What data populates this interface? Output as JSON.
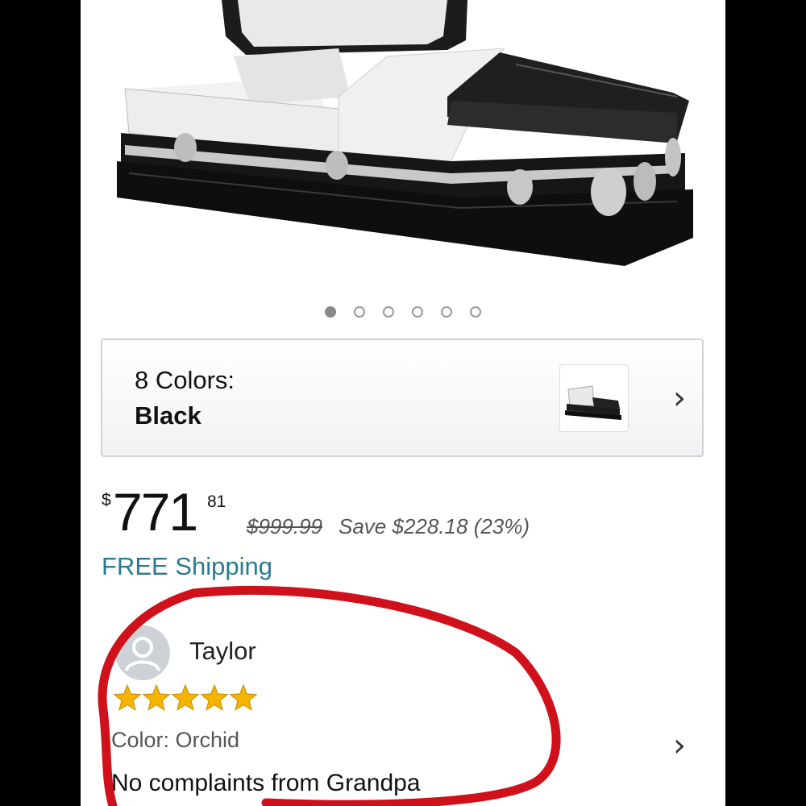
{
  "carousel": {
    "total": 6,
    "active_index": 0
  },
  "color_selector": {
    "count_label": "8 Colors:",
    "selected_color": "Black",
    "chevron_icon": "chevron-right-icon"
  },
  "price": {
    "currency_symbol": "$",
    "whole": "771",
    "fraction": "81",
    "list_price": "$999.99",
    "savings": "Save $228.18 (23%)",
    "shipping": "FREE Shipping"
  },
  "review": {
    "avatar_icon": "user-avatar-icon",
    "reviewer": "Taylor",
    "stars": 5,
    "color_line": "Color: Orchid",
    "text": "No complaints from Grandpa",
    "chevron_icon": "chevron-right-icon"
  },
  "colors": {
    "link": "#2a7a90",
    "star": "#f4b400",
    "annotation": "#d0101a"
  }
}
